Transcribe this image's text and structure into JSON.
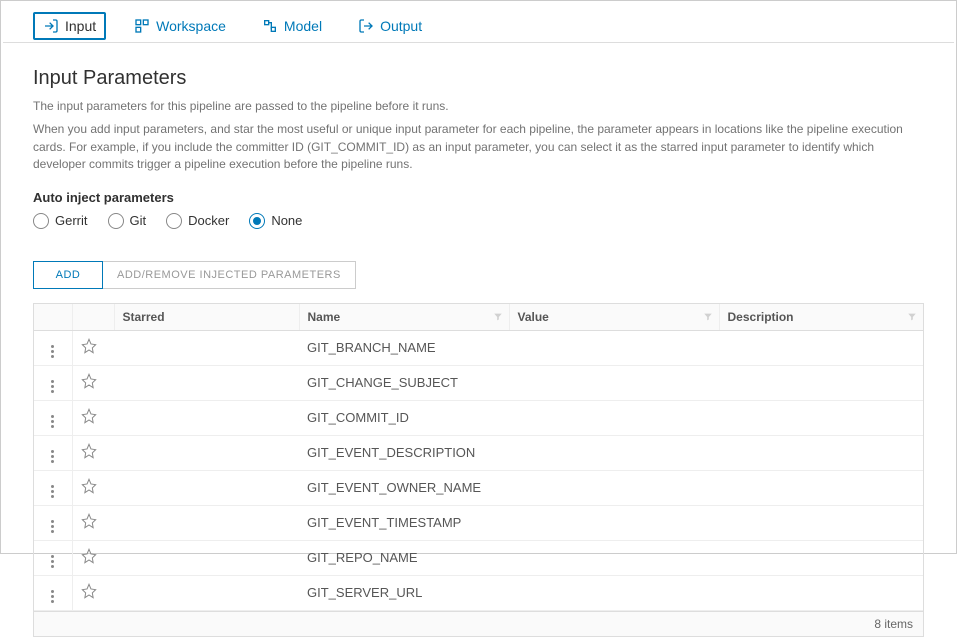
{
  "tabs": {
    "input": "Input",
    "workspace": "Workspace",
    "model": "Model",
    "output": "Output"
  },
  "page": {
    "title": "Input Parameters",
    "desc1": "The input parameters for this pipeline are passed to the pipeline before it runs.",
    "desc2": "When you add input parameters, and star the most useful or unique input parameter for each pipeline, the parameter appears in locations like the pipeline execution cards. For example, if you include the committer ID (GIT_COMMIT_ID) as an input parameter, you can select it as the starred input parameter to identify which developer commits trigger a pipeline execution before the pipeline runs."
  },
  "auto_inject": {
    "label": "Auto inject parameters",
    "options": {
      "gerrit": "Gerrit",
      "git": "Git",
      "docker": "Docker",
      "none": "None"
    },
    "selected": "none"
  },
  "buttons": {
    "add": "ADD",
    "add_remove": "ADD/REMOVE INJECTED PARAMETERS"
  },
  "columns": {
    "starred": "Starred",
    "name": "Name",
    "value": "Value",
    "description": "Description"
  },
  "rows": [
    {
      "name": "GIT_BRANCH_NAME",
      "value": "",
      "description": ""
    },
    {
      "name": "GIT_CHANGE_SUBJECT",
      "value": "",
      "description": ""
    },
    {
      "name": "GIT_COMMIT_ID",
      "value": "",
      "description": ""
    },
    {
      "name": "GIT_EVENT_DESCRIPTION",
      "value": "",
      "description": ""
    },
    {
      "name": "GIT_EVENT_OWNER_NAME",
      "value": "",
      "description": ""
    },
    {
      "name": "GIT_EVENT_TIMESTAMP",
      "value": "",
      "description": ""
    },
    {
      "name": "GIT_REPO_NAME",
      "value": "",
      "description": ""
    },
    {
      "name": "GIT_SERVER_URL",
      "value": "",
      "description": ""
    }
  ],
  "footer": {
    "count": "8 items"
  }
}
